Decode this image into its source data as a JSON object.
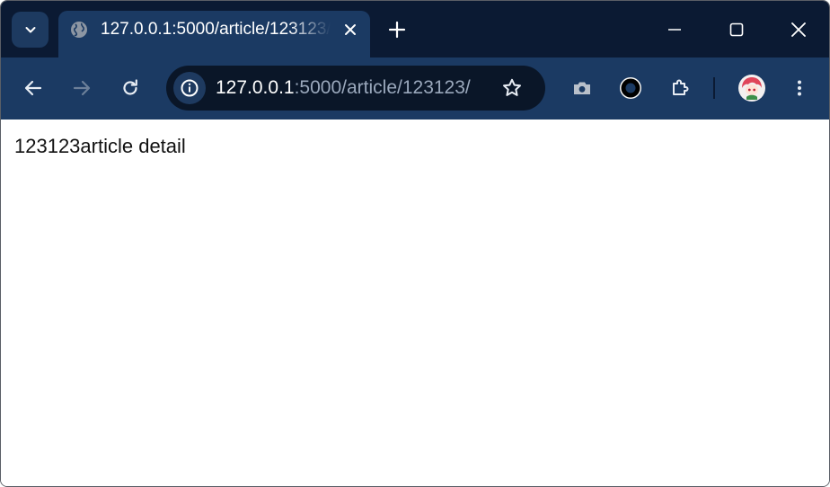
{
  "colors": {
    "tabstrip_bg": "#0b1a33",
    "toolbar_bg": "#1b3a63",
    "omnibox_bg": "#0a1628",
    "url_host": "#ffffff",
    "url_path": "#9aa8bc"
  },
  "browser": {
    "tab": {
      "title": "127.0.0.1:5000/article/123123/",
      "favicon": "globe-icon"
    },
    "toolbar": {
      "url_host": "127.0.0.1",
      "url_rest": ":5000/article/123123/"
    }
  },
  "page": {
    "heading": "123123article detail"
  }
}
